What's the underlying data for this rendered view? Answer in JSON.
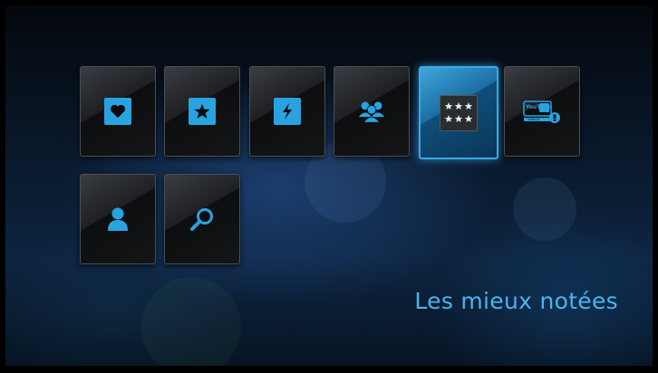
{
  "menu": {
    "caption": "Les mieux notées",
    "selected_index": 4,
    "tiles": [
      {
        "id": "favorites",
        "icon": "heart-icon"
      },
      {
        "id": "featured",
        "icon": "star-icon"
      },
      {
        "id": "most-recent",
        "icon": "lightning-icon"
      },
      {
        "id": "most-popular",
        "icon": "people-icon"
      },
      {
        "id": "top-rated",
        "icon": "rating-stars-icon"
      },
      {
        "id": "youtube",
        "icon": "youtube-videos-icon"
      },
      {
        "id": "account",
        "icon": "user-icon"
      },
      {
        "id": "search",
        "icon": "search-icon"
      }
    ],
    "youtube_logo_text": "YouTube",
    "youtube_sub_text": "VIDEOS"
  },
  "colors": {
    "accent": "#39a9e8",
    "icon_blue": "#29a3e0",
    "caption": "#4fb2ea"
  }
}
